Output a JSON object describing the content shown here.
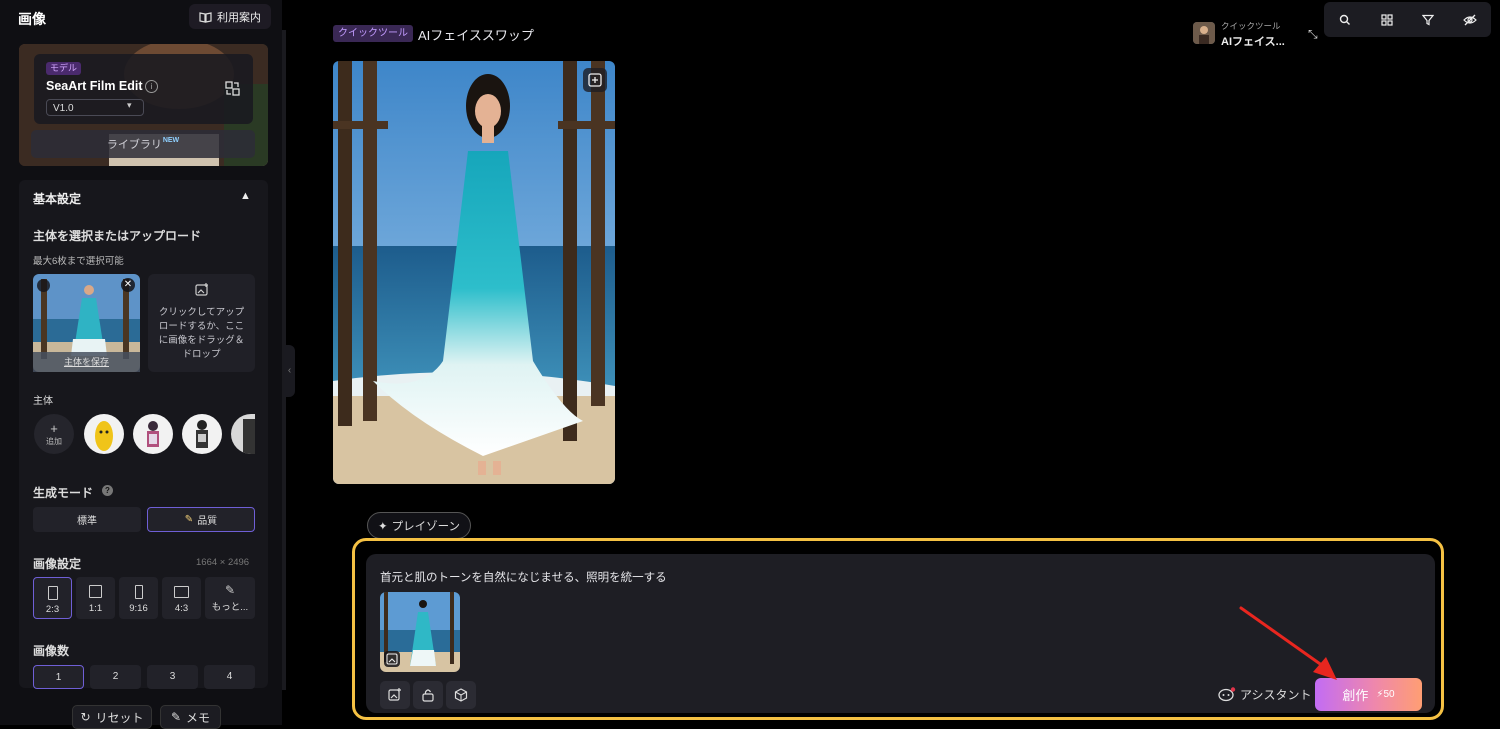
{
  "sidebar": {
    "title": "画像",
    "guide_button": "利用案内",
    "model": {
      "tag": "モデル",
      "name": "SeaArt Film Edit",
      "version": "V1.0",
      "library": "ライブラリ",
      "library_badge": "NEW"
    },
    "basic_settings": {
      "title": "基本設定",
      "subject_heading": "主体を選択またはアップロード",
      "subject_hint": "最大6枚まで選択可能",
      "save_subject": "主体を保存",
      "upload_text": "クリックしてアップロードするか、ここに画像をドラッグ＆ドロップ",
      "subject_label": "主体",
      "add_label": "追加",
      "mode_label": "生成モード",
      "mode_options": [
        "標準",
        "品質"
      ],
      "mode_selected": "品質",
      "image_settings_label": "画像設定",
      "resolution": "1664 × 2496",
      "ratios": [
        "2:3",
        "1:1",
        "9:16",
        "4:3",
        "もっと..."
      ],
      "ratio_selected": "2:3",
      "count_label": "画像数",
      "counts": [
        "1",
        "2",
        "3",
        "4"
      ],
      "count_selected": "1"
    },
    "footer": {
      "reset": "リセット",
      "memo": "メモ"
    }
  },
  "main": {
    "quick_tag": "クイックツール",
    "title": "AIフェイススワップ",
    "header_tool_small": "クイックツール",
    "header_tool_name": "AIフェイス...",
    "toolbar_icons": [
      "search-icon",
      "grid-icon",
      "filter-icon",
      "hide-icon"
    ],
    "playzone": "プレイゾーン",
    "prompt": "首元と肌のトーンを自然になじませる、照明を統一する",
    "assistant": "アシスタント",
    "create_label": "創作",
    "create_cost": "50"
  },
  "colors": {
    "highlight": "#f5c143",
    "accent": "#6f5fd6",
    "create_gradient_start": "#c26cf4",
    "create_gradient_end": "#ff9e73",
    "arrow": "#e8261f"
  }
}
